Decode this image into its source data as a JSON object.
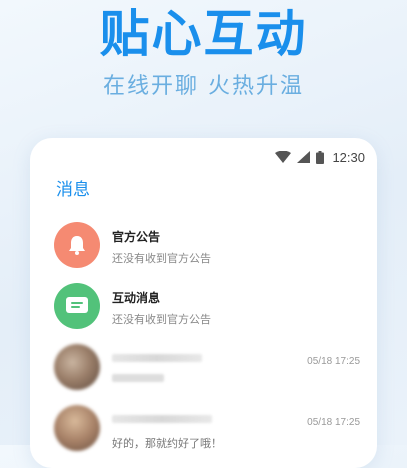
{
  "headline": "贴心互动",
  "subline": "在线开聊 火热升温",
  "status": {
    "time": "12:30"
  },
  "page_title": "消息",
  "colors": {
    "accent": "#1a8fec",
    "notice": "#f58a72",
    "interaction": "#52c27a"
  },
  "messages": [
    {
      "title": "官方公告",
      "subtitle": "还没有收到官方公告",
      "icon": "bell-icon"
    },
    {
      "title": "互动消息",
      "subtitle": "还没有收到官方公告",
      "icon": "chat-bubble-icon"
    },
    {
      "time": "05/18 17:25"
    },
    {
      "subtitle": "好的，那就约好了哦！",
      "time": "05/18 17:25"
    }
  ]
}
